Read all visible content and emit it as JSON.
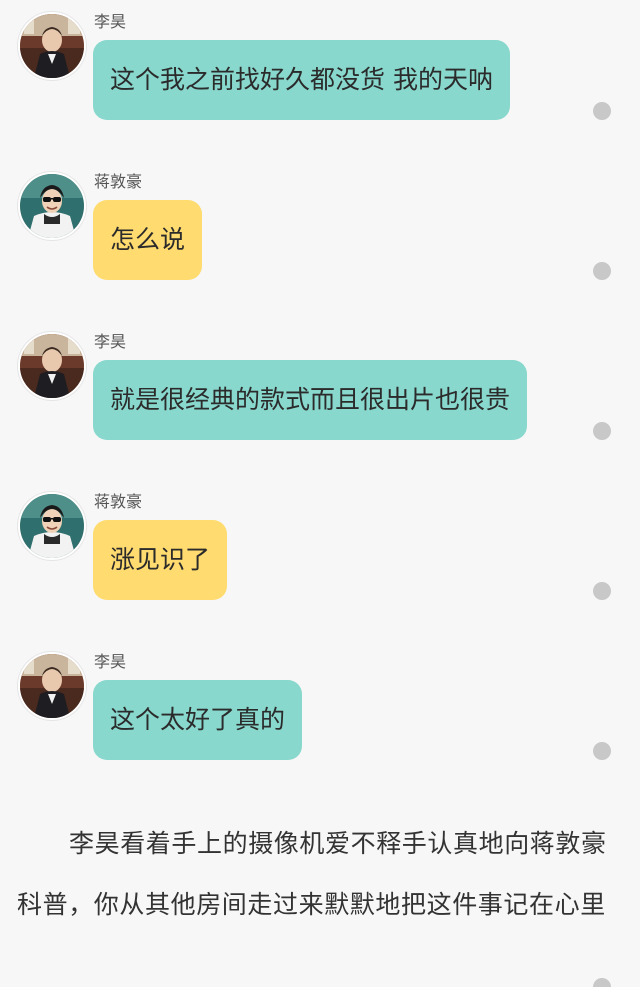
{
  "messages": [
    {
      "sender": "李昊",
      "text": "这个我之前找好久都没货 我的天呐",
      "avatar_icon": "avatar-lihao-icon",
      "bubble_color": "#88d8cd"
    },
    {
      "sender": "蒋敦豪",
      "text": "怎么说",
      "avatar_icon": "avatar-jiangdunhao-icon",
      "bubble_color": "#ffdb70"
    },
    {
      "sender": "李昊",
      "text": "就是很经典的款式而且很出片也很贵",
      "avatar_icon": "avatar-lihao-icon",
      "bubble_color": "#88d8cd"
    },
    {
      "sender": "蒋敦豪",
      "text": "涨见识了",
      "avatar_icon": "avatar-jiangdunhao-icon",
      "bubble_color": "#ffdb70"
    },
    {
      "sender": "李昊",
      "text": "这个太好了真的",
      "avatar_icon": "avatar-lihao-icon",
      "bubble_color": "#88d8cd"
    }
  ],
  "narration": "李昊看着手上的摄像机爱不释手认真地向蒋敦豪科普，你从其他房间走过来默默地把这件事记在心里",
  "colors": {
    "background": "#f7f7f7",
    "teal_bubble": "#88d8cd",
    "yellow_bubble": "#ffdb70",
    "dot": "#c8c8c8"
  }
}
